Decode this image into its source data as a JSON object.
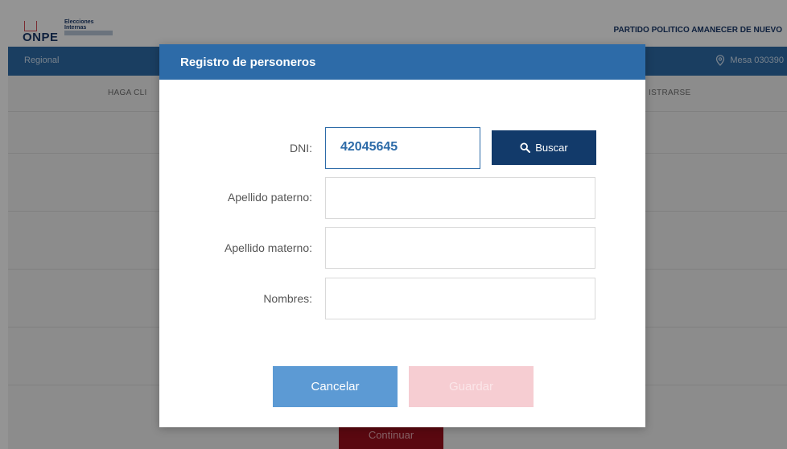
{
  "header": {
    "logo": {
      "brand": "ONPE",
      "line1": "Elecciones",
      "line2": "Internas"
    },
    "party_name": "PARTIDO POLITICO AMANECER DE NUEVO"
  },
  "nav": {
    "left_label": "Regional",
    "right_label": "Mesa 030390"
  },
  "background": {
    "instruction_left": "HAGA CLI",
    "instruction_right": "ISTRARSE",
    "continue_button": "Continuar"
  },
  "modal": {
    "title": "Registro de personeros",
    "fields": {
      "dni_label": "DNI:",
      "dni_value": "42045645",
      "apellido_paterno_label": "Apellido paterno:",
      "apellido_paterno_value": "",
      "apellido_materno_label": "Apellido materno:",
      "apellido_materno_value": "",
      "nombres_label": "Nombres:",
      "nombres_value": ""
    },
    "search_button": "Buscar",
    "cancel_button": "Cancelar",
    "save_button": "Guardar"
  },
  "colors": {
    "primary_blue": "#2d6ba8",
    "navy": "#123a6a",
    "cancel_blue": "#5c9ad4",
    "save_disabled_pink": "#f6cdd2",
    "continue_red": "#9c0e1c"
  },
  "icons": {
    "search": "search-icon",
    "location": "location-pin-icon"
  }
}
